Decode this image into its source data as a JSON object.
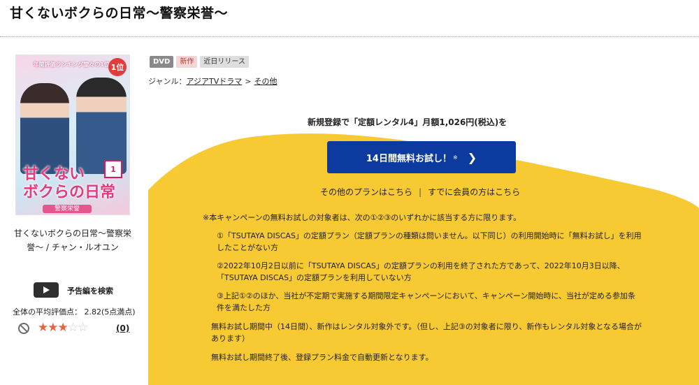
{
  "page": {
    "title": "甘くないボクらの日常〜警察栄誉〜"
  },
  "cover": {
    "rank_text": "年間評価ランキング堂々の1位!",
    "badge": "1位",
    "logo_text": "甘くない\nボクらの日常",
    "vol": "1",
    "subtitle": "警察栄誉"
  },
  "product": {
    "name": "甘くないボクらの日常〜警察栄誉〜 / チャン・ルオユン",
    "trailer_label": "予告編を検索",
    "rating_text": "全体の平均評価点： 2.82(5点満点)",
    "rating_value": 2.82,
    "rating_max": 5,
    "stars_filled": 3,
    "review_count": "(0)"
  },
  "tags": {
    "format": "DVD",
    "new": "新作",
    "release": "近日リリース"
  },
  "genre": {
    "label": "ジャンル：",
    "primary": "アジアTVドラマ",
    "separator": ">",
    "secondary": "その他"
  },
  "campaign": {
    "lead": "新規登録で「定額レンタル4」月額1,026円(税込)を",
    "button_label": "14日間無料お試し！",
    "button_note": "※",
    "other_plans": "その他のプランはこちら",
    "divider": "|",
    "member_link": "すでに会員の方はこちら",
    "terms_intro": "※本キャンペーンの無料お試しの対象者は、次の①②③のいずれかに該当する方に限ります。",
    "terms_items": [
      "①「TSUTAYA DISCAS」の定額プラン（定額プランの種類は問いません。以下同じ）の利用開始時に「無料お試し」を利用したことがない方",
      "②2022年10月2日以前に「TSUTAYA DISCAS」の定額プランの利用を終了された方であって、2022年10月3日以降、「TSUTAYA DISCAS」の定額プランを利用していない方",
      "③上記①②のほか、当社が不定期で実施する期間限定キャンペーンにおいて、キャンペーン開始時に、当社が定める参加条件を満たした方"
    ],
    "note_period": "無料お試し期間中（14日間）、新作はレンタル対象外です。（但し、上記③の対象者に限り、新作もレンタル対象となる場合があります）",
    "note_renewal": "無料お試し期間終了後、登録プラン料金で自動更新となります。"
  },
  "colors": {
    "campaign_yellow": "#f7c933",
    "button_blue": "#0d3a9f",
    "star_on": "#e8643a",
    "star_off": "#c9c9c9"
  }
}
